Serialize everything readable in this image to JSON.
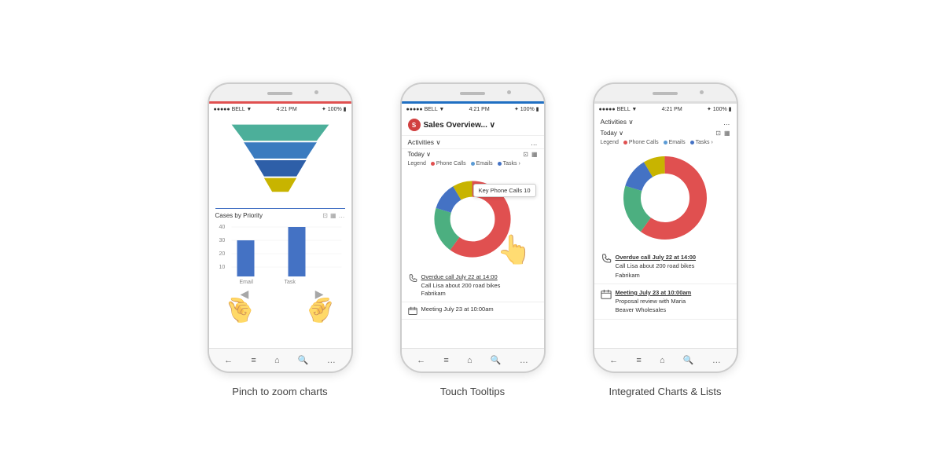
{
  "phones": [
    {
      "id": "phone1",
      "label": "Pinch to zoom charts",
      "status_left": "●●●●● BELL ▼",
      "status_center": "4:21 PM",
      "status_right": "✦ 100% ▮",
      "chart_title": "Cases by Priority",
      "nav_items": [
        "←",
        "≡",
        "⌂",
        "🔍",
        "…"
      ]
    },
    {
      "id": "phone2",
      "label": "Touch Tooltips",
      "status_left": "●●●●● BELL ▼",
      "status_center": "4:21 PM",
      "status_right": "✦ 100% ▮",
      "header_title": "Sales Overview... ∨",
      "section_title": "Activities ∨",
      "today_label": "Today ∨",
      "legend_label": "Legend",
      "legend_items": [
        {
          "color": "#e05050",
          "label": "Phone Calls"
        },
        {
          "color": "#5B9BD5",
          "label": "Emails"
        },
        {
          "color": "#4472C4",
          "label": "Tasks ›"
        }
      ],
      "tooltip_key": "Key",
      "tooltip_value": "Phone Calls 10",
      "activity1_title": "Overdue call July 22 at 14:00",
      "activity1_sub": "Call Lisa about 200 road bikes",
      "activity1_company": "Fabrikam",
      "activity2_title": "Meeting July 23 at 10:00am",
      "nav_items": [
        "←",
        "≡",
        "⌂",
        "🔍",
        "…"
      ]
    },
    {
      "id": "phone3",
      "label": "Integrated Charts & Lists",
      "status_left": "●●●●● BELL ▼",
      "status_center": "4:21 PM",
      "status_right": "✦ 100% ▮",
      "section_title": "Activities ∨",
      "today_label": "Today ∨",
      "legend_label": "Legend",
      "legend_items": [
        {
          "color": "#e05050",
          "label": "Phone Calls"
        },
        {
          "color": "#5B9BD5",
          "label": "Emails"
        },
        {
          "color": "#4472C4",
          "label": "Tasks ›"
        }
      ],
      "activity1_title": "Overdue call July 22 at 14:00",
      "activity1_sub": "Call Lisa about 200 road bikes",
      "activity1_company": "Fabrikam",
      "activity2_title": "Meeting July 23 at 10:00am",
      "activity2_sub": "Proposal review with Maria",
      "activity2_company": "Beaver Wholesales",
      "nav_items": [
        "←",
        "≡",
        "⌂",
        "🔍",
        "…"
      ]
    }
  ]
}
